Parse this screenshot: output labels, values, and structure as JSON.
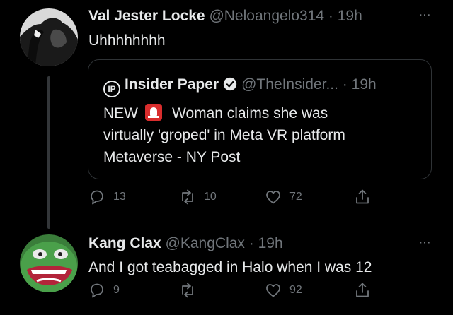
{
  "tweets": [
    {
      "name": "Val Jester Locke",
      "handle": "@Neloangelo314",
      "separator": "·",
      "time": "19h",
      "more": "···",
      "text": "Uhhhhhhhh",
      "quote": {
        "logo": "IP",
        "name": "Insider Paper",
        "handle": "@TheInsider...",
        "separator": "·",
        "time": "19h",
        "line1_prefix": "NEW",
        "line1_suffix": "Woman claims she was",
        "line2": "virtually 'groped' in Meta VR platform",
        "line3": "Metaverse - NY Post"
      },
      "actions": {
        "replies": "13",
        "retweets": "10",
        "likes": "72"
      }
    },
    {
      "name": "Kang Clax",
      "handle": "@KangClax",
      "separator": "·",
      "time": "19h",
      "more": "···",
      "text": "And I got teabagged in Halo when I was 12",
      "actions": {
        "replies": "9",
        "retweets": "",
        "likes": "92"
      }
    }
  ],
  "icons": {
    "reply": "reply-icon",
    "retweet": "retweet-icon",
    "like": "heart-icon",
    "share": "share-icon",
    "verified": "verified-badge-icon",
    "siren": "police-siren-emoji"
  },
  "colors": {
    "background": "#000000",
    "text": "#e7e9ea",
    "muted": "#71767b",
    "border": "#2f3336",
    "siren": "#d92d2d"
  }
}
